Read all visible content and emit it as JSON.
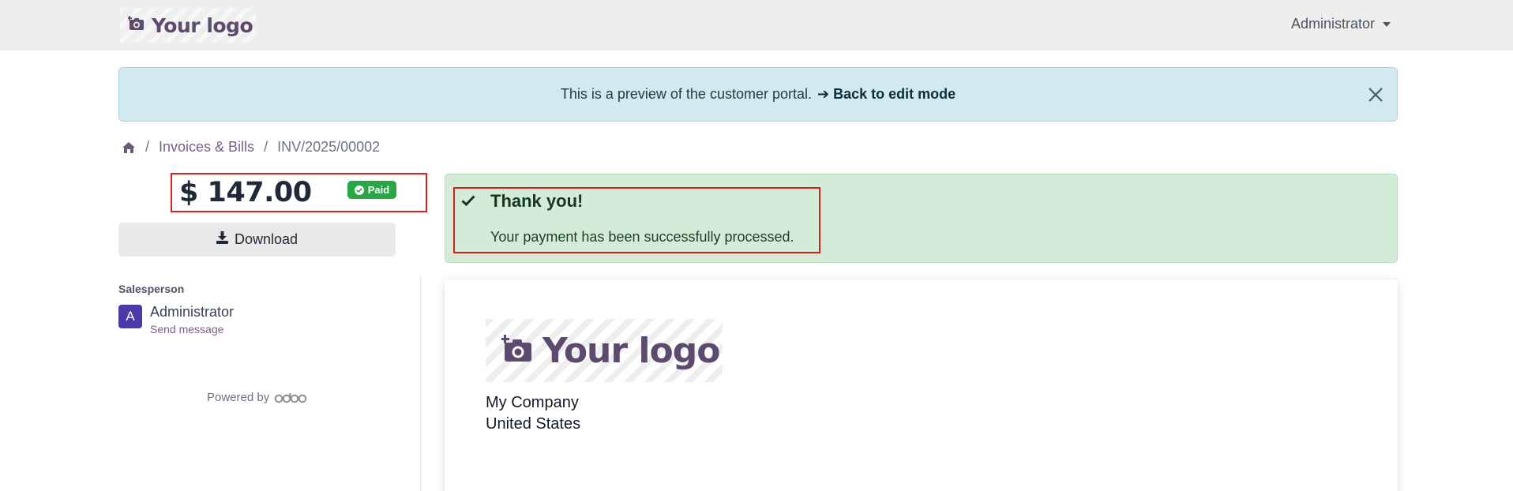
{
  "navbar": {
    "logo_text": "Your logo",
    "user_name": "Administrator"
  },
  "preview_alert": {
    "message": "This is a preview of the customer portal.",
    "arrow": "➔",
    "link_label": "Back to edit mode"
  },
  "breadcrumb": {
    "items": [
      "Invoices & Bills",
      "INV/2025/00002"
    ],
    "separator": "/"
  },
  "invoice": {
    "amount": "$ 147.00",
    "status": "Paid",
    "download_label": "Download"
  },
  "salesperson": {
    "title": "Salesperson",
    "avatar_letter": "A",
    "name": "Administrator",
    "send_message_label": "Send message"
  },
  "footer": {
    "powered_by": "Powered by",
    "brand": "odoo"
  },
  "success": {
    "title": "Thank you!",
    "message": "Your payment has been successfully processed."
  },
  "document": {
    "logo_text": "Your logo",
    "company_name": "My Company",
    "company_country": "United States"
  },
  "colors": {
    "brand": "#5d4a6e",
    "paid": "#28a745",
    "info_bg": "#d1e9ef",
    "success_bg": "#d4ebd8",
    "highlight": "#e01b1b"
  }
}
